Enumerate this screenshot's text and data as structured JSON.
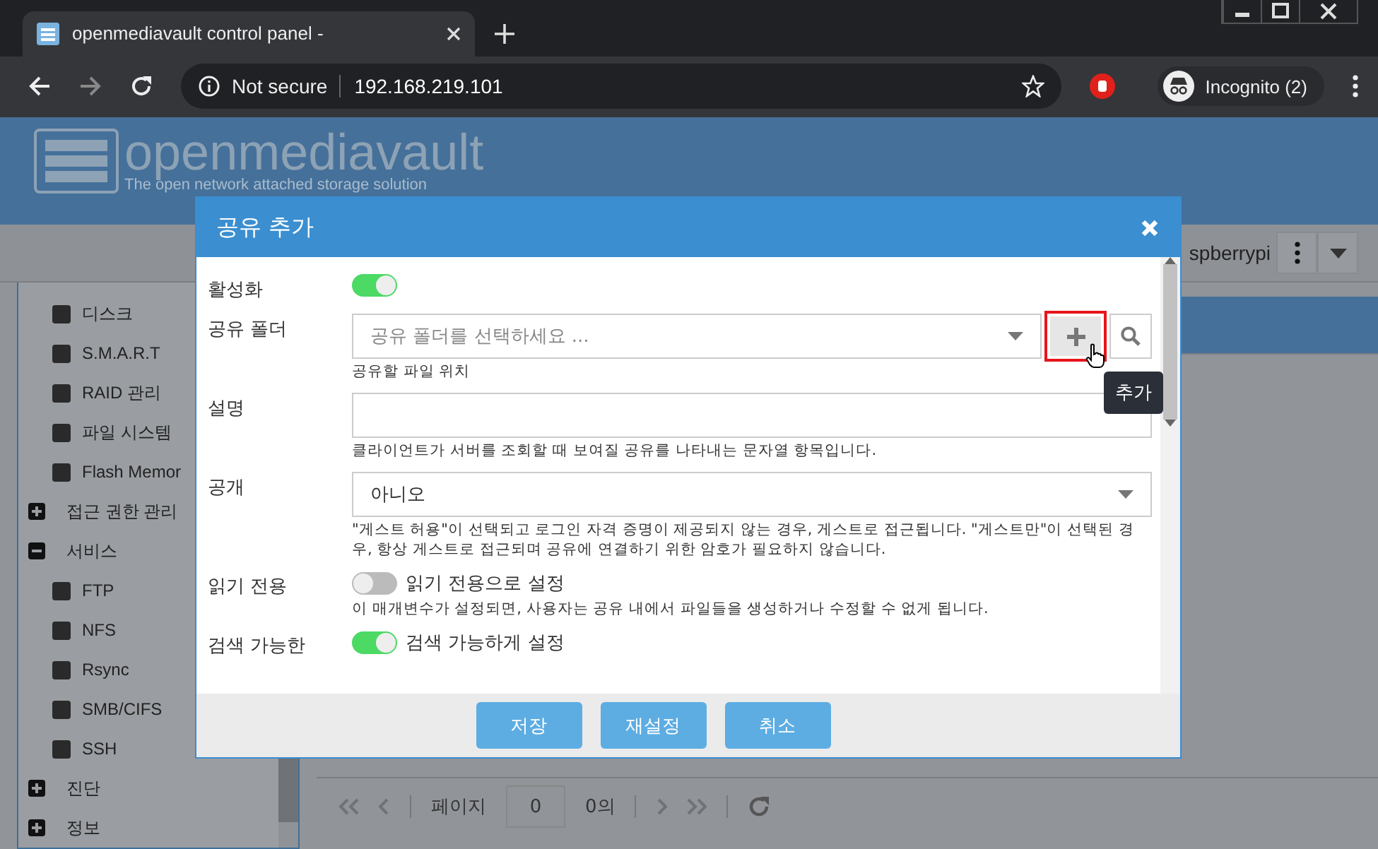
{
  "browser": {
    "tab_title": "openmediavault control panel -",
    "security": "Not secure",
    "url": "192.168.219.101",
    "profile": "Incognito (2)"
  },
  "app": {
    "logo_text": "openmediavault",
    "tagline": "The open network attached storage solution",
    "hostname": "spberrypi"
  },
  "sidebar": {
    "items": [
      {
        "kind": "leaf",
        "label": "디스크"
      },
      {
        "kind": "leaf",
        "label": "S.M.A.R.T"
      },
      {
        "kind": "leaf",
        "label": "RAID 관리"
      },
      {
        "kind": "leaf",
        "label": "파일 시스템"
      },
      {
        "kind": "leaf",
        "label": "Flash Memor"
      },
      {
        "kind": "group",
        "label": "접근 권한 관리",
        "expanded": false
      },
      {
        "kind": "group",
        "label": "서비스",
        "expanded": true,
        "children": [
          {
            "label": "FTP"
          },
          {
            "label": "NFS"
          },
          {
            "label": "Rsync"
          },
          {
            "label": "SMB/CIFS"
          },
          {
            "label": "SSH"
          }
        ]
      },
      {
        "kind": "group",
        "label": "진단",
        "expanded": false
      },
      {
        "kind": "group",
        "label": "정보",
        "expanded": false
      }
    ]
  },
  "pager": {
    "label": "페이지",
    "value": "0",
    "total": "0의"
  },
  "dialog": {
    "title": "공유 추가",
    "fields": [
      {
        "kind": "toggle",
        "label": "활성화",
        "on": true
      },
      {
        "kind": "combo",
        "label": "공유 폴더",
        "placeholder": "공유 폴더를 선택하세요 ...",
        "hint": "공유할 파일 위치"
      },
      {
        "kind": "text",
        "label": "설명",
        "hint": "클라이언트가 서버를 조회할 때 보여질 공유를 나타내는 문자열 항목입니다."
      },
      {
        "kind": "select",
        "label": "공개",
        "value": "아니오",
        "hint": "\"게스트 허용\"이 선택되고 로그인 자격 증명이 제공되지 않는 경우, 게스트로 접근됩니다. \"게스트만\"이 선택된 경우, 항상 게스트로 접근되며 공유에 연결하기 위한 암호가 필요하지 않습니다."
      },
      {
        "kind": "toggle",
        "label": "읽기 전용",
        "on": false,
        "caption": "읽기 전용으로 설정",
        "hint": "이 매개변수가 설정되면, 사용자는 공유 내에서 파일들을 생성하거나 수정할 수 없게 됩니다."
      },
      {
        "kind": "toggle",
        "label": "검색 가능한",
        "on": true,
        "caption": "검색 가능하게 설정"
      }
    ],
    "buttons": [
      "저장",
      "재설정",
      "취소"
    ],
    "tooltip": "추가"
  }
}
